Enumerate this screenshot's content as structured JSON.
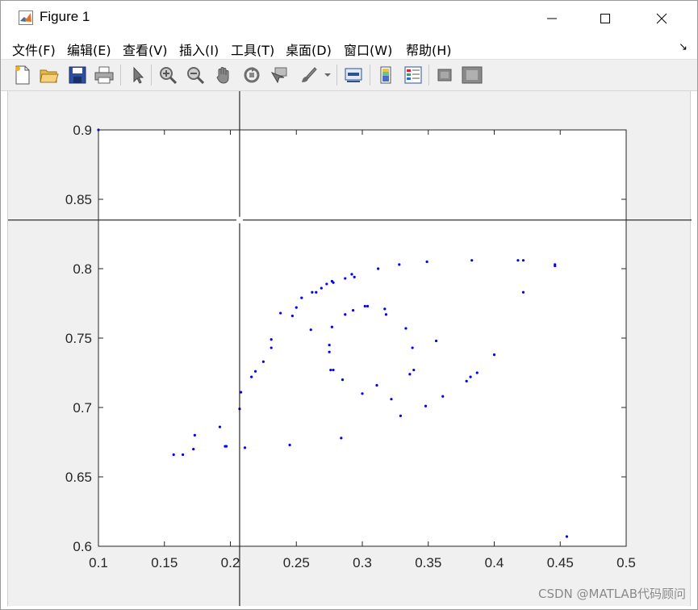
{
  "window": {
    "title": "Figure 1",
    "minimize_glyph": "minimize-icon",
    "maximize_glyph": "maximize-icon",
    "close_glyph": "close-icon"
  },
  "menu": {
    "items": [
      "文件(F)",
      "编辑(E)",
      "查看(V)",
      "插入(I)",
      "工具(T)",
      "桌面(D)",
      "窗口(W)",
      "帮助(H)"
    ],
    "corner": "↘"
  },
  "toolbar": {
    "buttons": [
      "new-figure-icon",
      "open-file-icon",
      "save-icon",
      "print-icon",
      "select-arrow-icon",
      "zoom-in-icon",
      "zoom-out-icon",
      "pan-hand-icon",
      "rotate-3d-icon",
      "data-cursor-icon",
      "brush-icon",
      "brush-dropdown-icon",
      "link-plot-icon",
      "colorbar-icon",
      "legend-icon",
      "hide-plot-tools-icon",
      "show-plot-tools-icon"
    ]
  },
  "colors": {
    "marker": "#0000ff",
    "crosshair": "#000000",
    "figure_bg": "#f0f0f0",
    "axes_bg": "#ffffff"
  },
  "watermark": "CSDN @MATLAB代码顾问",
  "chart_data": {
    "type": "scatter",
    "title": "",
    "xlabel": "",
    "ylabel": "",
    "xlim": [
      0.1,
      0.5
    ],
    "ylim": [
      0.6,
      0.9
    ],
    "xticks": [
      "0.1",
      "0.15",
      "0.2",
      "0.25",
      "0.3",
      "0.35",
      "0.4",
      "0.45",
      "0.5"
    ],
    "yticks": [
      "0.6",
      "0.65",
      "0.7",
      "0.75",
      "0.8",
      "0.85",
      "0.9"
    ],
    "grid": false,
    "legend": "none",
    "crosshair": {
      "x": 0.207,
      "y": 0.835
    },
    "series": [
      {
        "points": [
          [
            0.1,
            0.9
          ],
          [
            0.157,
            0.666
          ],
          [
            0.164,
            0.666
          ],
          [
            0.172,
            0.67
          ],
          [
            0.173,
            0.68
          ],
          [
            0.192,
            0.686
          ],
          [
            0.196,
            0.672
          ],
          [
            0.197,
            0.672
          ],
          [
            0.207,
            0.699
          ],
          [
            0.208,
            0.711
          ],
          [
            0.211,
            0.671
          ],
          [
            0.216,
            0.722
          ],
          [
            0.219,
            0.726
          ],
          [
            0.225,
            0.733
          ],
          [
            0.231,
            0.743
          ],
          [
            0.231,
            0.749
          ],
          [
            0.238,
            0.768
          ],
          [
            0.245,
            0.673
          ],
          [
            0.247,
            0.766
          ],
          [
            0.25,
            0.772
          ],
          [
            0.254,
            0.779
          ],
          [
            0.261,
            0.756
          ],
          [
            0.262,
            0.783
          ],
          [
            0.265,
            0.783
          ],
          [
            0.269,
            0.786
          ],
          [
            0.273,
            0.789
          ],
          [
            0.275,
            0.74
          ],
          [
            0.275,
            0.745
          ],
          [
            0.276,
            0.727
          ],
          [
            0.277,
            0.758
          ],
          [
            0.277,
            0.791
          ],
          [
            0.278,
            0.79
          ],
          [
            0.278,
            0.727
          ],
          [
            0.284,
            0.678
          ],
          [
            0.285,
            0.72
          ],
          [
            0.287,
            0.767
          ],
          [
            0.287,
            0.793
          ],
          [
            0.292,
            0.796
          ],
          [
            0.293,
            0.77
          ],
          [
            0.294,
            0.794
          ],
          [
            0.3,
            0.71
          ],
          [
            0.302,
            0.773
          ],
          [
            0.304,
            0.773
          ],
          [
            0.311,
            0.716
          ],
          [
            0.312,
            0.8
          ],
          [
            0.317,
            0.771
          ],
          [
            0.318,
            0.767
          ],
          [
            0.322,
            0.706
          ],
          [
            0.328,
            0.803
          ],
          [
            0.329,
            0.694
          ],
          [
            0.333,
            0.757
          ],
          [
            0.336,
            0.724
          ],
          [
            0.338,
            0.743
          ],
          [
            0.339,
            0.727
          ],
          [
            0.348,
            0.701
          ],
          [
            0.349,
            0.805
          ],
          [
            0.356,
            0.748
          ],
          [
            0.361,
            0.708
          ],
          [
            0.379,
            0.719
          ],
          [
            0.382,
            0.722
          ],
          [
            0.383,
            0.806
          ],
          [
            0.387,
            0.725
          ],
          [
            0.4,
            0.738
          ],
          [
            0.418,
            0.806
          ],
          [
            0.422,
            0.806
          ],
          [
            0.422,
            0.783
          ],
          [
            0.446,
            0.803
          ],
          [
            0.446,
            0.802
          ],
          [
            0.455,
            0.607
          ]
        ]
      }
    ]
  }
}
